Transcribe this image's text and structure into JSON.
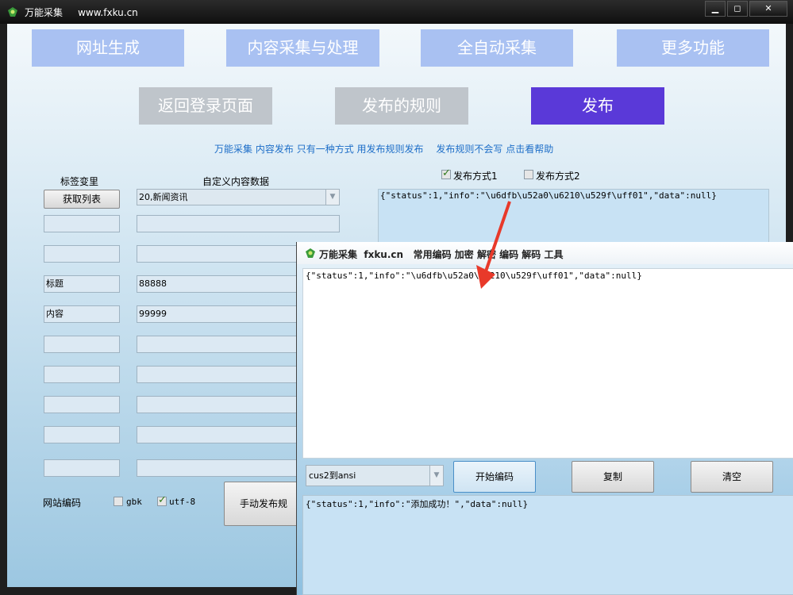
{
  "window": {
    "title": "万能采集",
    "url": "www.fxku.cn",
    "controls": {
      "minimize": "▁",
      "maximize": "◻",
      "close": "✕"
    }
  },
  "nav": [
    "网址生成",
    "内容采集与处理",
    "全自动采集",
    "更多功能"
  ],
  "actions": {
    "back": "返回登录页面",
    "rules": "发布的规则",
    "publish": "发布"
  },
  "help_links": [
    "万能采集",
    "内容发布",
    "只有一种方式",
    "用发布规则发布",
    "发布规则不会写",
    "点击看帮助"
  ],
  "tags": {
    "header_tag": "标签变里",
    "header_content": "自定义内容数据",
    "fetch_button": "获取列表",
    "category_value": "20,新闻资讯",
    "rows": [
      {
        "tag": "",
        "value": ""
      },
      {
        "tag": "",
        "value": ""
      },
      {
        "tag": "标题",
        "value": "88888"
      },
      {
        "tag": "内容",
        "value": "99999"
      },
      {
        "tag": "",
        "value": ""
      },
      {
        "tag": "",
        "value": ""
      },
      {
        "tag": "",
        "value": ""
      },
      {
        "tag": "",
        "value": ""
      },
      {
        "tag": "",
        "value": ""
      }
    ]
  },
  "encoding": {
    "label": "网站编码",
    "gbk": {
      "label": "gbk",
      "checked": false
    },
    "utf8": {
      "label": "utf-8",
      "checked": true
    }
  },
  "manual_publish_button": "手动发布规",
  "publish_modes": [
    {
      "label": "发布方式1",
      "checked": true
    },
    {
      "label": "发布方式2",
      "checked": false
    }
  ],
  "response_text": "{\"status\":1,\"info\":\"\\u6dfb\\u52a0\\u6210\\u529f\\uff01\",\"data\":null}",
  "popup": {
    "title": "万能采集  fxku.cn   常用编码 加密 解密 编码 解码 工具",
    "input_text": "{\"status\":1,\"info\":\"\\u6dfb\\u52a0\\u6210\\u529f\\uff01\",\"data\":null}",
    "mode_value": "cus2到ansi",
    "start_button": "开始编码",
    "copy_button": "复制",
    "clear_button": "清空",
    "output_text": "{\"status\":1,\"info\":\"添加成功！\",\"data\":null}"
  },
  "colors": {
    "publish_active": "#5a39d8",
    "nav_button": "#a9c1f2",
    "arrow": "#e8392a",
    "link": "#1e6ec8"
  }
}
